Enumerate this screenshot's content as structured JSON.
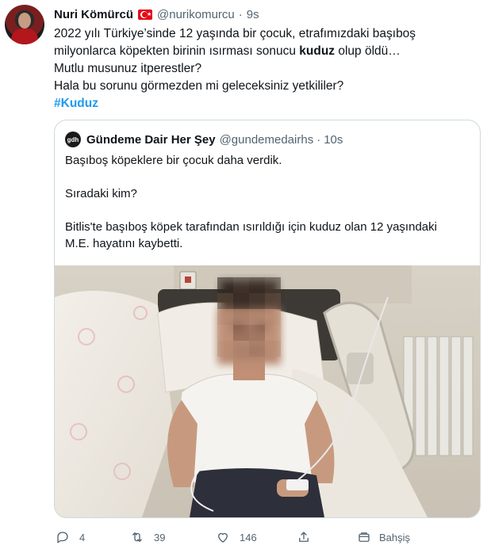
{
  "author": {
    "name": "Nuri Kömürcü",
    "handle": "@nurikomurcu",
    "time": "9s"
  },
  "tweet": {
    "line1": "2022 yılı Türkiye’sinde 12 yaşında bir çocuk, etrafımızdaki başıboş",
    "line2_before": "milyonlarca köpekten birinin ısırması sonucu ",
    "line2_bold": "kuduz",
    "line2_after": " olup öldü…",
    "line3": "Mutlu musunuz itperestler?",
    "line4": "Hala bu sorunu görmezden mi geleceksiniz yetkililer?",
    "hashtag": "#Kuduz"
  },
  "quote": {
    "logo_text": "gdh",
    "name": "Gündeme Dair Her Şey",
    "handle": "@gundemedairhs",
    "time": "10s",
    "line1": "Başıboş köpeklere bir çocuk daha verdik.",
    "line2": "Sıradaki kim?",
    "line3": "Bitlis'te başıboş köpek tarafından ısırıldığı için kuduz olan 12 yaşındaki",
    "line4": "M.E. hayatını kaybetti."
  },
  "actions": {
    "replies": "4",
    "retweets": "39",
    "likes": "146",
    "tip_label": "Bahşiş"
  },
  "colors": {
    "accent": "#1d9bf0",
    "secondary_text": "#536471",
    "border": "#cfd9de"
  },
  "icons": [
    "reply-icon",
    "retweet-icon",
    "like-icon",
    "share-icon",
    "tip-icon"
  ]
}
